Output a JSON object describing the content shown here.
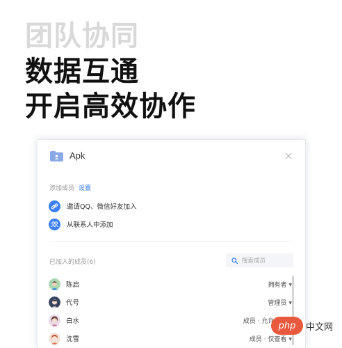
{
  "hero": {
    "line1": "团队协同",
    "line2": "数据互通",
    "line3": "开启高效协作"
  },
  "dialog": {
    "title": "Apk",
    "add_members_label": "添加成员",
    "settings_link": "设置",
    "actions": [
      {
        "label": "邀请QQ、微信好友加入",
        "icon": "link-icon"
      },
      {
        "label": "从联系人中添加",
        "icon": "contacts-icon"
      }
    ],
    "joined_label": "已加入的成员(6)",
    "search_placeholder": "搜索成员",
    "members": [
      {
        "name": "陈启",
        "role": "拥有者"
      },
      {
        "name": "代号",
        "role": "管理员"
      },
      {
        "name": "白水",
        "role": "成员 · 允许编辑"
      },
      {
        "name": "沈雪",
        "role": "成员 · 仅查看"
      }
    ]
  },
  "watermark": {
    "badge": "php",
    "text": "中文网"
  },
  "colors": {
    "accent": "#3d7ff4",
    "link": "#2f7bf5"
  }
}
